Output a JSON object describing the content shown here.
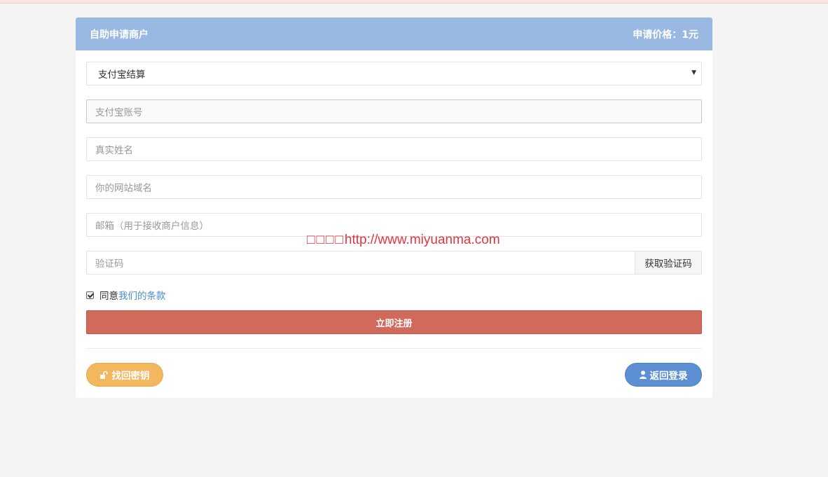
{
  "panel": {
    "title": "自助申请商户",
    "price": "申请价格：1元"
  },
  "form": {
    "settlement_select": {
      "value": "支付宝结算",
      "options": [
        "支付宝结算"
      ]
    },
    "account_placeholder": "支付宝账号",
    "realname_placeholder": "真实姓名",
    "domain_placeholder": "你的网站域名",
    "email_placeholder": "邮箱（用于接收商户信息）",
    "code_placeholder": "验证码",
    "get_code_label": "获取验证码",
    "agree_prefix": "同意",
    "agree_link": "我们的条款",
    "agree_checked": true,
    "submit_label": "立即注册"
  },
  "footer": {
    "forgot_label": "找回密钥",
    "back_label": "返回登录"
  },
  "watermark": {
    "boxes": "□□□□",
    "url": "http://www.miyuanma.com"
  },
  "colors": {
    "header": "#99b9e3",
    "submit": "#d26a5c",
    "forgot": "#f3b760",
    "back": "#5c90d2",
    "link": "#4a8bc9"
  },
  "icons": {
    "forgot": "unlock-icon",
    "back": "user-icon",
    "select": "caret-down-icon"
  }
}
